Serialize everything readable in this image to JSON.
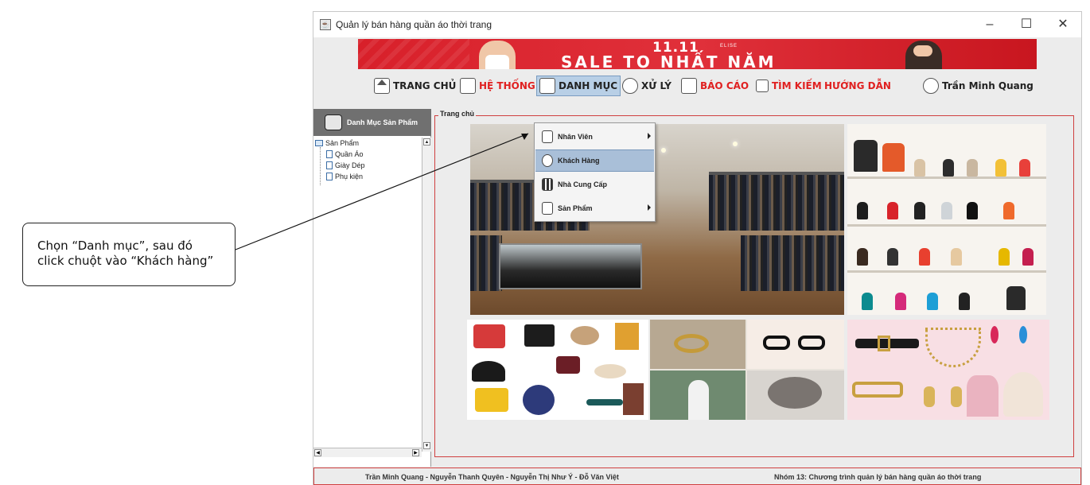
{
  "window": {
    "title": "Quản lý bán hàng quần áo thời trang",
    "minimize_icon": "minimize-icon",
    "maximize_icon": "maximize-icon",
    "close_icon": "close-icon"
  },
  "banner": {
    "date": "11.11",
    "brand": "ELISE",
    "headline": "SALE TO NHẤT NĂM",
    "accent_color": "#d8202a"
  },
  "menubar": {
    "items": [
      {
        "label": "TRANG CHỦ",
        "icon": "home-icon",
        "color": "#222222"
      },
      {
        "label": "HỆ THỐNG",
        "icon": "monitor-icon",
        "color": "#e02020"
      },
      {
        "label": "DANH MỤC",
        "icon": "list-icon",
        "color": "#222222",
        "active": true
      },
      {
        "label": "XỬ LÝ",
        "icon": "process-icon",
        "color": "#222222"
      },
      {
        "label": "BÁO CÁO",
        "icon": "report-icon",
        "color": "#e02020"
      },
      {
        "label": "TÌM KIẾM",
        "icon": "search-icon",
        "color": "#e02020"
      },
      {
        "label": "HƯỚNG DẪN",
        "icon": "",
        "color": "#e02020"
      }
    ],
    "user": {
      "name": "Trần Minh Quang",
      "icon": "user-icon"
    }
  },
  "dropdown": {
    "items": [
      {
        "label": "Nhân Viên",
        "icon": "employee-icon",
        "submenu": true
      },
      {
        "label": "Khách Hàng",
        "icon": "customer-icon",
        "submenu": false,
        "highlighted": true
      },
      {
        "label": "Nhà Cung Cấp",
        "icon": "qr-icon",
        "submenu": false
      },
      {
        "label": "Sản Phẩm",
        "icon": "cart-icon",
        "submenu": true
      }
    ]
  },
  "left_panel": {
    "header": "Danh Mục Sản Phẩm",
    "tree": {
      "root": "Sản Phẩm",
      "children": [
        "Quần Áo",
        "Giày Dép",
        "Phụ kiện"
      ]
    }
  },
  "main_panel": {
    "legend": "Trang chủ"
  },
  "footer": {
    "authors": "Trần Minh Quang - Nguyễn Thanh Quyên - Nguyễn Thị Như Ý - Đỗ Văn Việt",
    "group": "Nhóm 13: Chương trình quản lý bán hàng quần áo thời trang"
  },
  "callout": {
    "line1": "Chọn “Danh mục”, sau đó",
    "line2": "click chuột vào “Khách hàng”"
  }
}
